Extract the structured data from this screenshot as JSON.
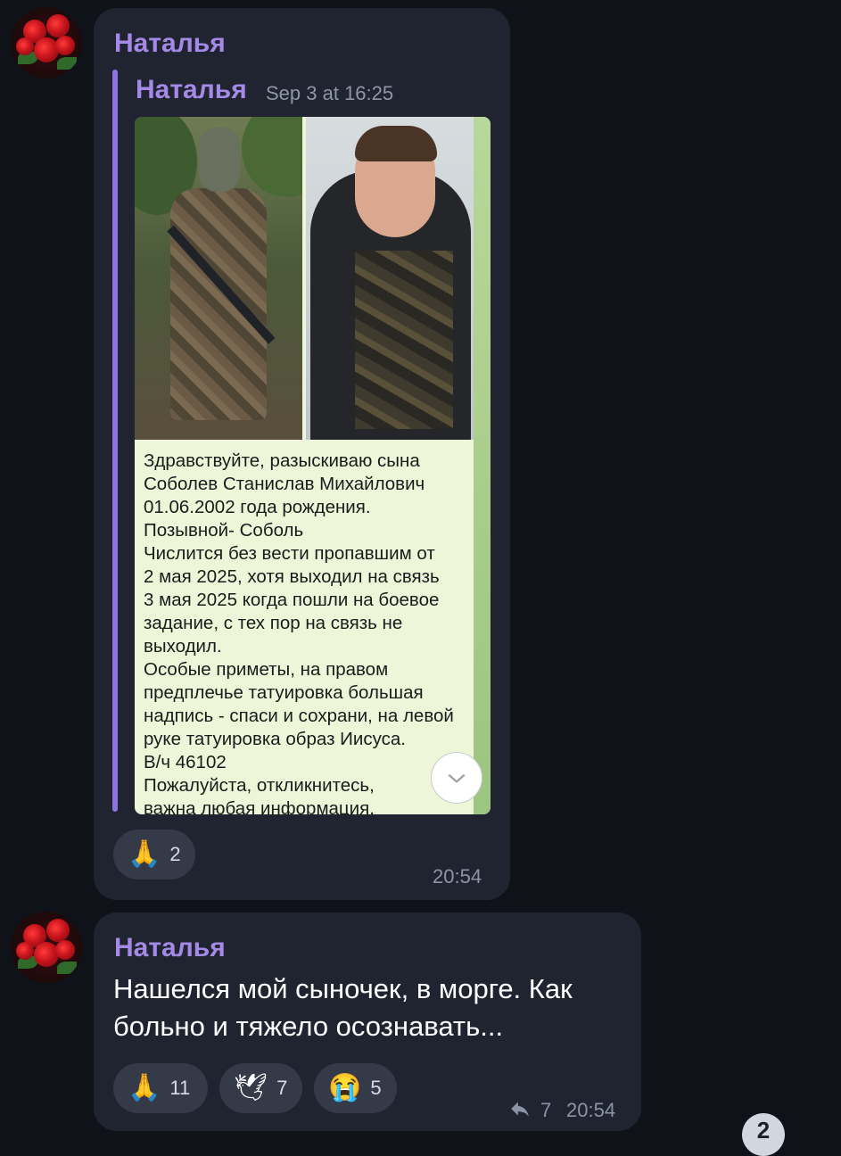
{
  "message1": {
    "sender": "Наталья",
    "forwarded_from": "Наталья",
    "forwarded_date": "Sep 3 at 16:25",
    "media_text": "Здравствуйте, разыскиваю сына\nСоболев Станислав Михайлович\n01.06.2002 года рождения.\nПозывной- Соболь\nЧислится без вести пропавшим от\n2 мая 2025, хотя выходил на связь\n3 мая 2025 когда пошли на боевое\nзадание, с тех пор на связь не\nвыходил.\nОсобые приметы, на правом\nпредплечье татуировка большая\nнадпись - спаси и сохрани, на левой\nруке татуировка образ Иисуса.\nВ/ч 46102\nПожалуйста, откликнитесь,\n важна любая информация.",
    "reactions": [
      {
        "emoji": "🙏",
        "count": "2"
      }
    ],
    "time": "20:54"
  },
  "message2": {
    "sender": "Наталья",
    "text": "Нашелся мой сыночек, в морге. Как больно и тяжело осознавать...",
    "reactions": [
      {
        "emoji": "🙏",
        "count": "11"
      },
      {
        "emoji": "🕊",
        "count": "7"
      },
      {
        "emoji": "😭",
        "count": "5"
      }
    ],
    "reply_count": "7",
    "time": "20:54"
  },
  "unread_badge": "2",
  "icons": [
    "avatar-roses",
    "chevron-down-icon",
    "reply-arrow-icon"
  ]
}
